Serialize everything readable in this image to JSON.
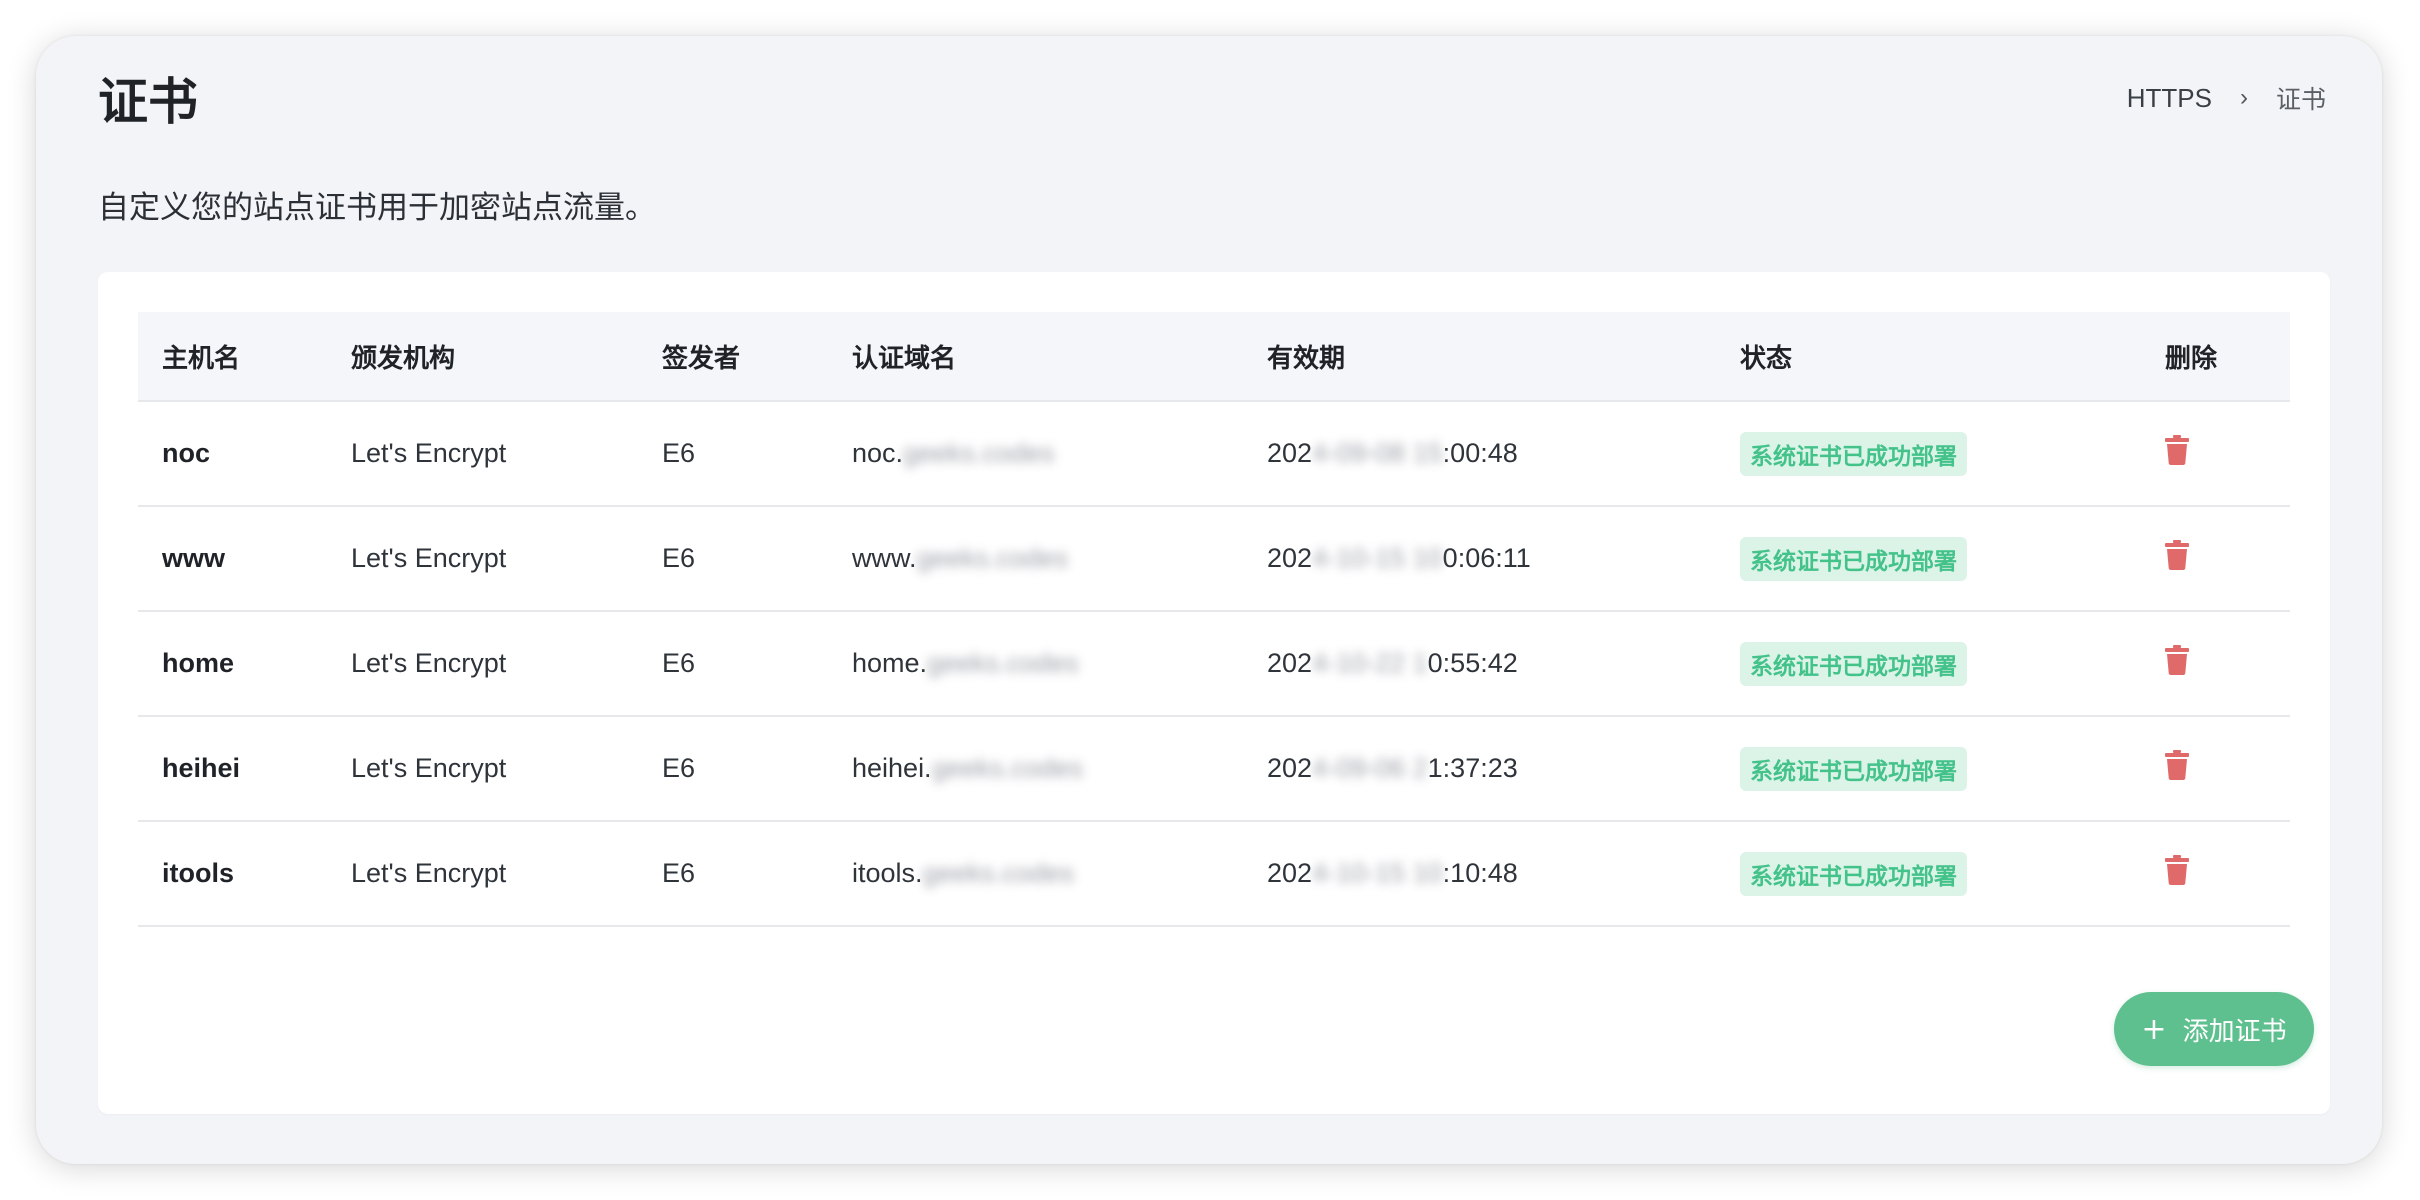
{
  "header": {
    "title": "证书",
    "subtitle": "自定义您的站点证书用于加密站点流量。",
    "breadcrumb": {
      "parent": "HTTPS",
      "separator": "›",
      "current": "证书"
    }
  },
  "table": {
    "columns": {
      "host": "主机名",
      "issuer": "颁发机构",
      "signer": "签发者",
      "domain": "认证域名",
      "expiry": "有效期",
      "status": "状态",
      "delete": "删除"
    },
    "rows": [
      {
        "host": "noc",
        "issuer": "Let's Encrypt",
        "signer": "E6",
        "domain_visible": "noc.",
        "domain_blurred": "geeks.codes",
        "expiry_start": "202",
        "expiry_blurred": "4-09-08 15",
        "expiry_end": ":00:48",
        "status": "系统证书已成功部署"
      },
      {
        "host": "www",
        "issuer": "Let's Encrypt",
        "signer": "E6",
        "domain_visible": "www.",
        "domain_blurred": "geeks.codes",
        "expiry_start": "202",
        "expiry_blurred": "4-10-15 10",
        "expiry_end": "0:06:11",
        "status": "系统证书已成功部署"
      },
      {
        "host": "home",
        "issuer": "Let's Encrypt",
        "signer": "E6",
        "domain_visible": "home.",
        "domain_blurred": "geeks.codes",
        "expiry_start": "202",
        "expiry_blurred": "4-10-22 1",
        "expiry_end": "0:55:42",
        "status": "系统证书已成功部署"
      },
      {
        "host": "heihei",
        "issuer": "Let's Encrypt",
        "signer": "E6",
        "domain_visible": "heihei.",
        "domain_blurred": "geeks.codes",
        "expiry_start": "202",
        "expiry_blurred": "4-09-06 2",
        "expiry_end": "1:37:23",
        "status": "系统证书已成功部署"
      },
      {
        "host": "itools",
        "issuer": "Let's Encrypt",
        "signer": "E6",
        "domain_visible": "itools.",
        "domain_blurred": "geeks.codes",
        "expiry_start": "202",
        "expiry_blurred": "4-10-15 10",
        "expiry_end": ":10:48",
        "status": "系统证书已成功部署"
      }
    ]
  },
  "actions": {
    "add_plus": "+",
    "add_label": "添加证书"
  },
  "icons": {
    "delete": "trash-icon",
    "add": "plus-icon"
  },
  "colors": {
    "accent": "#5fc08f",
    "badge_bg": "#dcf3e8",
    "badge_text": "#43c28a",
    "danger": "#e06a6a"
  }
}
